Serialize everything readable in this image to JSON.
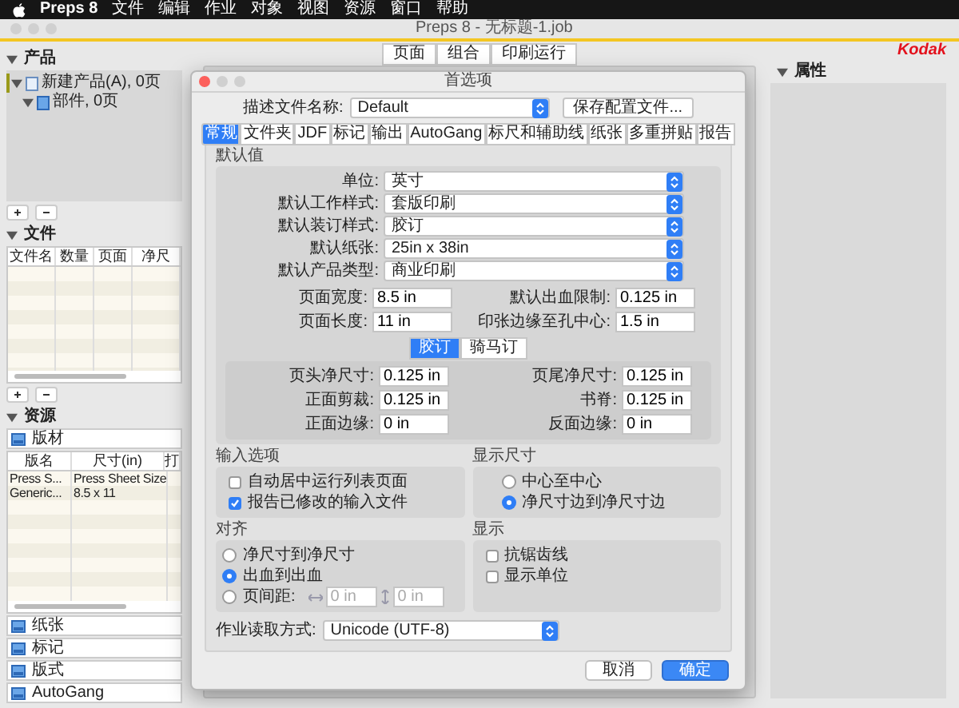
{
  "menu_bar": {
    "app": "Preps 8",
    "items": [
      "文件",
      "编辑",
      "作业",
      "对象",
      "视图",
      "资源",
      "窗口",
      "帮助"
    ]
  },
  "window": {
    "title": "Preps 8 - 无标题-1.job"
  },
  "brand": "Kodak",
  "products_panel": {
    "title": "产品",
    "expanded": true,
    "tree": [
      {
        "label": "新建产品(A), 0页",
        "expanded": true,
        "children": [
          {
            "label": "部件, 0页",
            "expanded": true
          }
        ]
      }
    ]
  },
  "files_panel": {
    "title": "文件",
    "expanded": true,
    "columns": [
      "文件名",
      "数量",
      "页面",
      "净尺"
    ]
  },
  "resources_panel": {
    "title": "资源",
    "expanded": true,
    "sections": [
      {
        "label": "版材",
        "expanded": true,
        "columns": [
          "版名",
          "尺寸(in)",
          "打"
        ],
        "rows": [
          [
            "Press S...",
            "Press Sheet Size"
          ],
          [
            "Generic...",
            "8.5 x 11"
          ]
        ]
      },
      {
        "label": "纸张",
        "expanded": false
      },
      {
        "label": "标记",
        "expanded": false
      },
      {
        "label": "版式",
        "expanded": false
      },
      {
        "label": "AutoGang",
        "expanded": false
      }
    ]
  },
  "view_tabs": [
    {
      "label": "页面",
      "selected": false
    },
    {
      "label": "组合",
      "selected": false
    },
    {
      "label": "印刷运行",
      "selected": false
    }
  ],
  "properties_panel": {
    "title": "属性",
    "expanded": true
  },
  "dialog": {
    "title": "首选项",
    "profile": {
      "label": "描述文件名称:",
      "value": "Default",
      "save_button": "保存配置文件..."
    },
    "tabs": [
      {
        "label": "常规",
        "selected": true
      },
      {
        "label": "文件夹",
        "selected": false
      },
      {
        "label": "JDF",
        "selected": false
      },
      {
        "label": "标记",
        "selected": false
      },
      {
        "label": "输出",
        "selected": false
      },
      {
        "label": "AutoGang",
        "selected": false
      },
      {
        "label": "标尺和辅助线",
        "selected": false
      },
      {
        "label": "纸张",
        "selected": false
      },
      {
        "label": "多重拼贴",
        "selected": false
      },
      {
        "label": "报告",
        "selected": false
      }
    ],
    "defaults_title": "默认值",
    "selects": [
      {
        "label": "单位:",
        "value": "英寸"
      },
      {
        "label": "默认工作样式:",
        "value": "套版印刷"
      },
      {
        "label": "默认装订样式:",
        "value": "胶订"
      },
      {
        "label": "默认纸张:",
        "value": "25in x 38in"
      },
      {
        "label": "默认产品类型:",
        "value": "商业印刷"
      }
    ],
    "size_fields": [
      {
        "label": "页面宽度:",
        "value": "8.5 in"
      },
      {
        "label": "默认出血限制:",
        "value": "0.125 in"
      },
      {
        "label": "页面长度:",
        "value": "11 in"
      },
      {
        "label": "印张边缘至孔中心:",
        "value": "1.5 in"
      }
    ],
    "binding_tabs": [
      {
        "label": "胶订",
        "selected": true
      },
      {
        "label": "骑马订",
        "selected": false
      }
    ],
    "binding_fields": [
      {
        "label": "页头净尺寸:",
        "value": "0.125 in"
      },
      {
        "label": "页尾净尺寸:",
        "value": "0.125 in"
      },
      {
        "label": "正面剪裁:",
        "value": "0.125 in"
      },
      {
        "label": "书脊:",
        "value": "0.125 in"
      },
      {
        "label": "正面边缘:",
        "value": "0 in"
      },
      {
        "label": "反面边缘:",
        "value": "0 in"
      }
    ],
    "input_options": {
      "title": "输入选项",
      "checkboxes": [
        {
          "label": "自动居中运行列表页面",
          "checked": false
        },
        {
          "label": "报告已修改的输入文件",
          "checked": true
        }
      ]
    },
    "display_size": {
      "title": "显示尺寸",
      "radios": [
        {
          "label": "中心至中心",
          "selected": false
        },
        {
          "label": "净尺寸边到净尺寸边",
          "selected": true
        }
      ]
    },
    "alignment": {
      "title": "对齐",
      "radios": [
        {
          "label": "净尺寸到净尺寸",
          "selected": false
        },
        {
          "label": "出血到出血",
          "selected": true
        },
        {
          "label": "页间距:",
          "selected": false,
          "fields": [
            "0 in",
            "0 in"
          ],
          "disabled": true
        }
      ]
    },
    "display": {
      "title": "显示",
      "checkboxes": [
        {
          "label": "抗锯齿线",
          "checked": false
        },
        {
          "label": "显示单位",
          "checked": false
        }
      ]
    },
    "read_method": {
      "label": "作业读取方式:",
      "value": "Unicode (UTF-8)"
    },
    "buttons": [
      {
        "label": "取消",
        "default": false
      },
      {
        "label": "确定",
        "default": true
      }
    ]
  }
}
